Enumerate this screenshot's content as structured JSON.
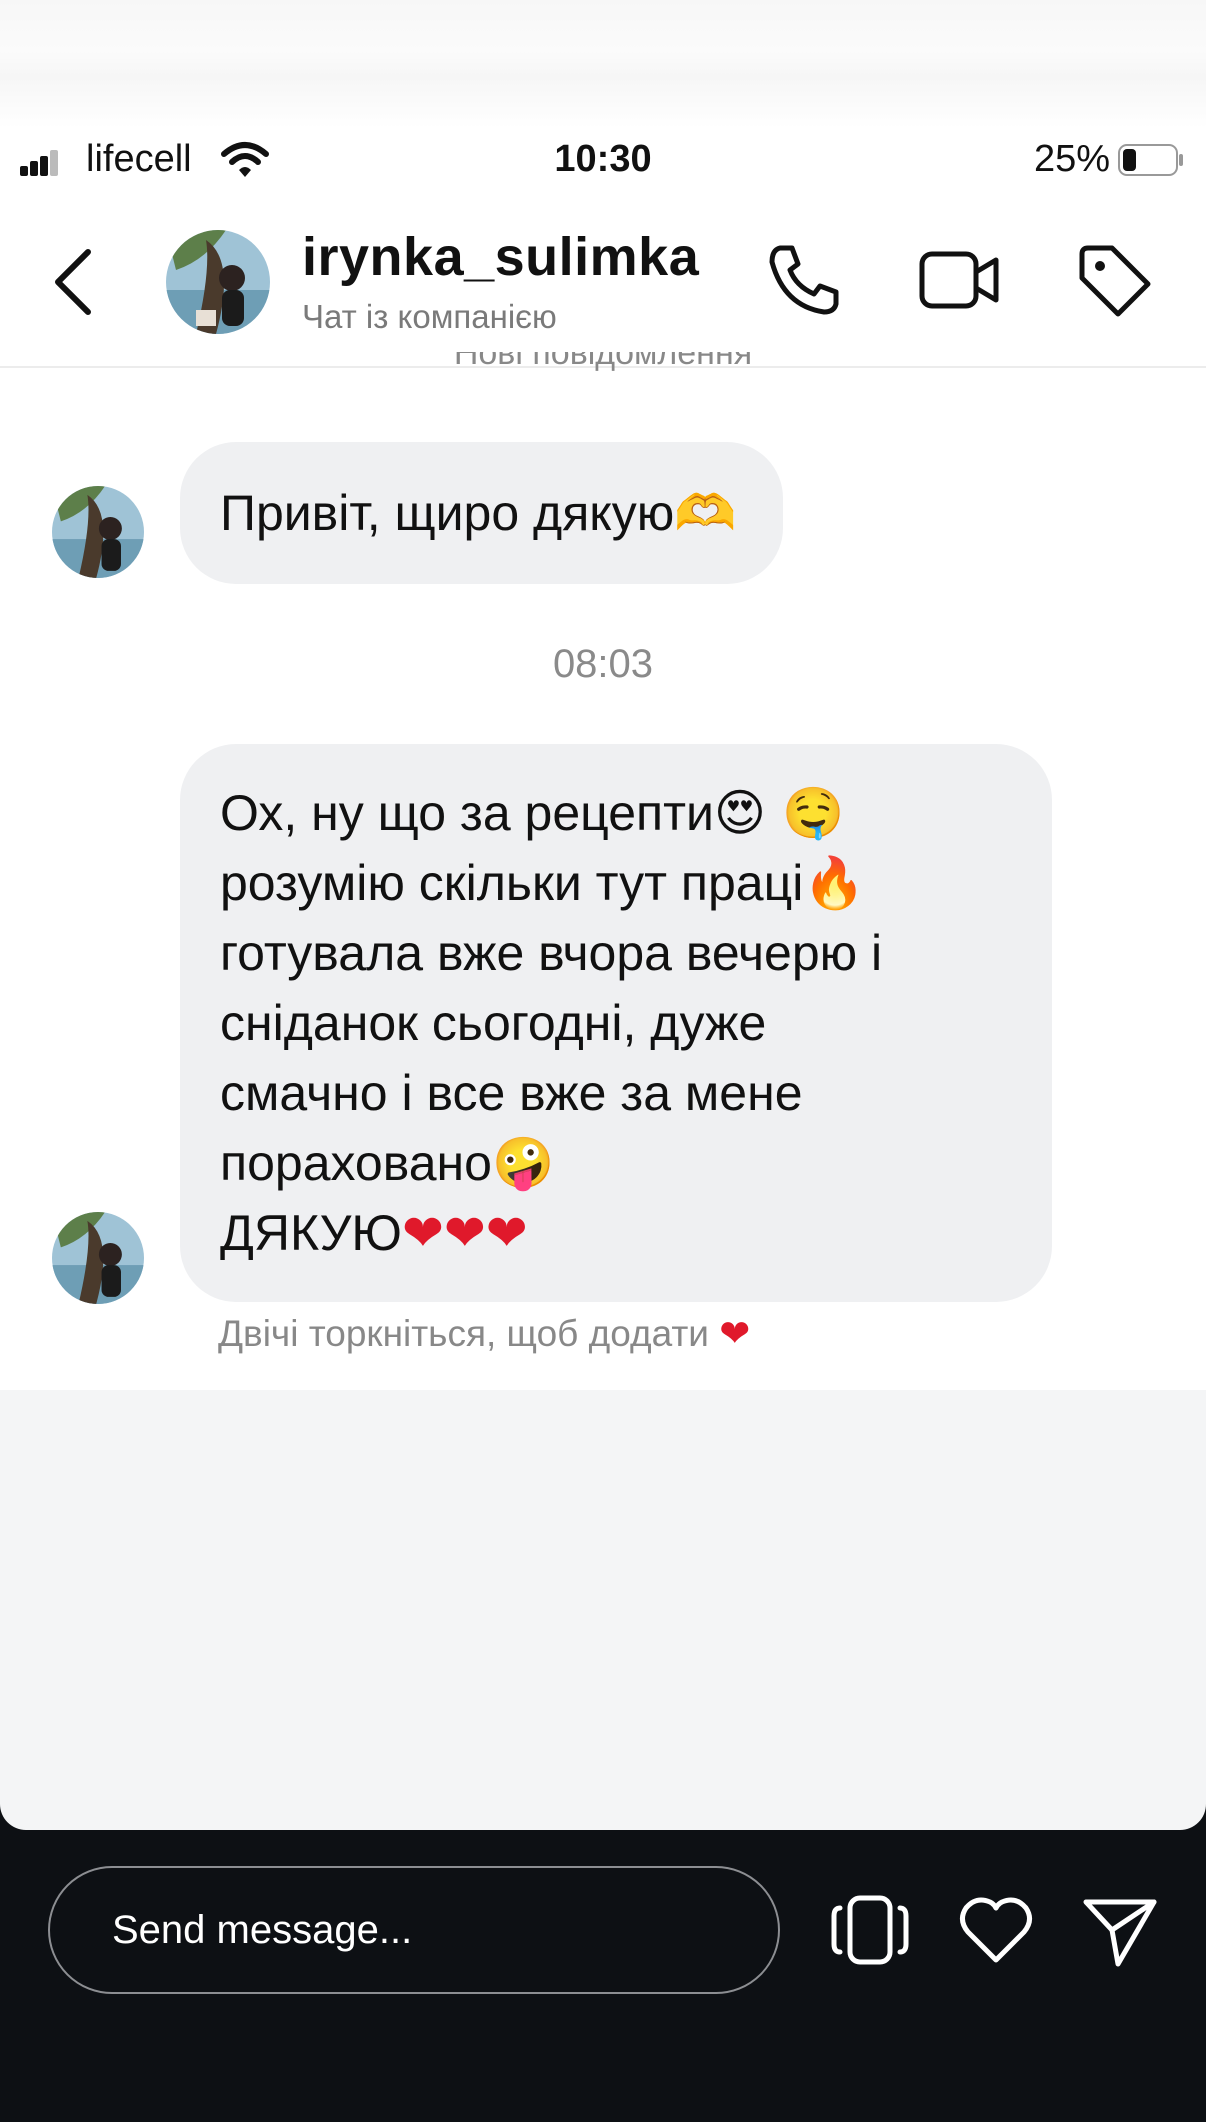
{
  "status_bar": {
    "carrier": "lifecell",
    "time": "10:30",
    "battery_percent": "25%",
    "battery_level": 0.25,
    "icons": [
      "signal-bars-icon",
      "wifi-icon",
      "battery-icon"
    ]
  },
  "header": {
    "username": "irynka_sulimka",
    "subtitle": "Чат із компанією",
    "icons": [
      "back-icon",
      "phone-icon",
      "video-call-icon",
      "tag-icon"
    ]
  },
  "conversation": {
    "new_messages_divider": "Нові повідомлення",
    "messages": [
      {
        "text": "Привіт, щиро дякую",
        "emoji": "🫶"
      },
      {
        "lines": [
          {
            "text": "Ох, ну що за рецепти",
            "emoji": "😍 🤤"
          },
          {
            "text": "розумію скільки тут праці",
            "emoji": "🔥"
          },
          {
            "text": "готувала вже вчора вечерю і",
            "emoji": ""
          },
          {
            "text": "сніданок сьогодні, дуже",
            "emoji": ""
          },
          {
            "text": "смачно і все вже за мене",
            "emoji": ""
          },
          {
            "text": "пораховано",
            "emoji": "🤪"
          },
          {
            "text": "ДЯКУЮ",
            "emoji": "❤❤❤"
          }
        ]
      }
    ],
    "timestamp": "08:03",
    "double_tap_hint": "Двічі торкніться, щоб додати",
    "double_tap_emoji": "❤"
  },
  "reply_bar": {
    "placeholder": "Send message...",
    "icons": [
      "flip-camera-icon",
      "heart-icon",
      "send-icon"
    ]
  },
  "colors": {
    "bubble_bg": "#eff0f2",
    "page_bg_dark": "#0d1014",
    "sheet_bg": "#f4f5f6",
    "heart_red": "#e0192b"
  }
}
